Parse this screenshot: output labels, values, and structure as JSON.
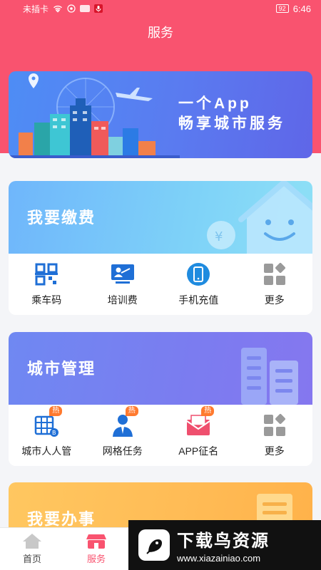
{
  "status_bar": {
    "carrier": "未插卡",
    "battery": "92",
    "time": "6:46"
  },
  "page": {
    "title": "服务"
  },
  "banner": {
    "line1": "一个App",
    "line2": "畅享城市服务"
  },
  "cards": [
    {
      "title": "我要缴费",
      "items": [
        {
          "label": "乘车码",
          "icon": "qr-code-icon",
          "hot": ""
        },
        {
          "label": "培训费",
          "icon": "training-icon",
          "hot": ""
        },
        {
          "label": "手机充值",
          "icon": "phone-icon",
          "hot": ""
        },
        {
          "label": "更多",
          "icon": "more-grid-icon",
          "hot": ""
        }
      ]
    },
    {
      "title": "城市管理",
      "items": [
        {
          "label": "城市人人管",
          "icon": "building-icon",
          "hot": "热"
        },
        {
          "label": "网格任务",
          "icon": "person-icon",
          "hot": "热"
        },
        {
          "label": "APP征名",
          "icon": "envelope-icon",
          "hot": "热"
        },
        {
          "label": "更多",
          "icon": "more-grid-icon",
          "hot": ""
        }
      ]
    },
    {
      "title": "我要办事"
    }
  ],
  "bottom_nav": [
    {
      "label": "首页",
      "icon": "home-icon"
    },
    {
      "label": "服务",
      "icon": "store-icon"
    }
  ],
  "watermark": {
    "title": "下载鸟资源",
    "url": "www.xiazainiao.com"
  },
  "colors": {
    "primary": "#f9536f",
    "accent_blue": "#1f6fd6",
    "accent_orange": "#ff7a2f"
  }
}
